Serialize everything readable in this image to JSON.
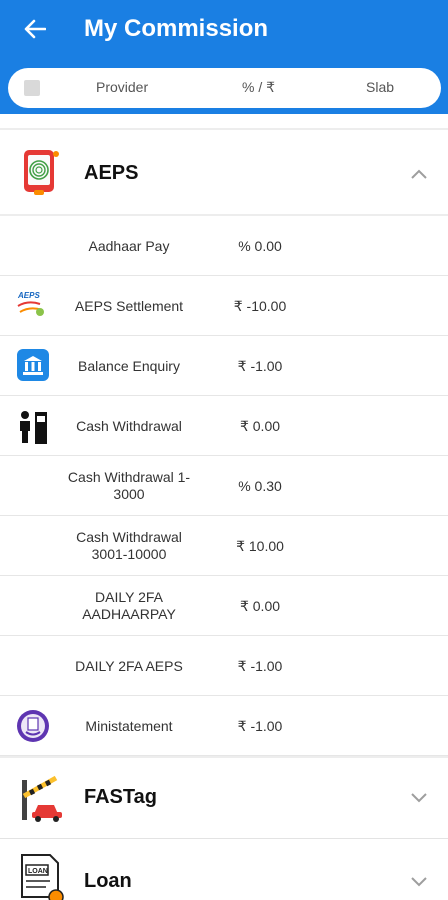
{
  "app_bar": {
    "title": "My Commission",
    "header_columns": {
      "provider": "Provider",
      "percent_rupee": "% / ₹",
      "slab": "Slab"
    }
  },
  "groups": [
    {
      "title": "AEPS",
      "expanded": true,
      "rows": [
        {
          "name": "Aadhaar Pay",
          "value": "% 0.00",
          "icon": "none"
        },
        {
          "name": "AEPS Settlement",
          "value": "₹ -10.00",
          "icon": "aeps-logo-icon"
        },
        {
          "name": "Balance Enquiry",
          "value": "₹ -1.00",
          "icon": "bank-icon"
        },
        {
          "name": "Cash Withdrawal",
          "value": "₹ 0.00",
          "icon": "atm-person-icon"
        },
        {
          "name": "Cash Withdrawal 1-3000",
          "value": "% 0.30",
          "icon": "none"
        },
        {
          "name": "Cash Withdrawal 3001-10000",
          "value": "₹ 10.00",
          "icon": "none"
        },
        {
          "name": "DAILY 2FA AADHAARPAY",
          "value": "₹ 0.00",
          "icon": "none"
        },
        {
          "name": "DAILY 2FA AEPS",
          "value": "₹ -1.00",
          "icon": "none"
        },
        {
          "name": "Ministatement",
          "value": "₹ -1.00",
          "icon": "statement-icon"
        }
      ]
    },
    {
      "title": "FASTag",
      "expanded": false,
      "rows": []
    },
    {
      "title": "Loan",
      "expanded": false,
      "rows": []
    }
  ],
  "colors": {
    "primary": "#1a7fe3",
    "text": "#333333",
    "divider": "#e6e6e6"
  }
}
